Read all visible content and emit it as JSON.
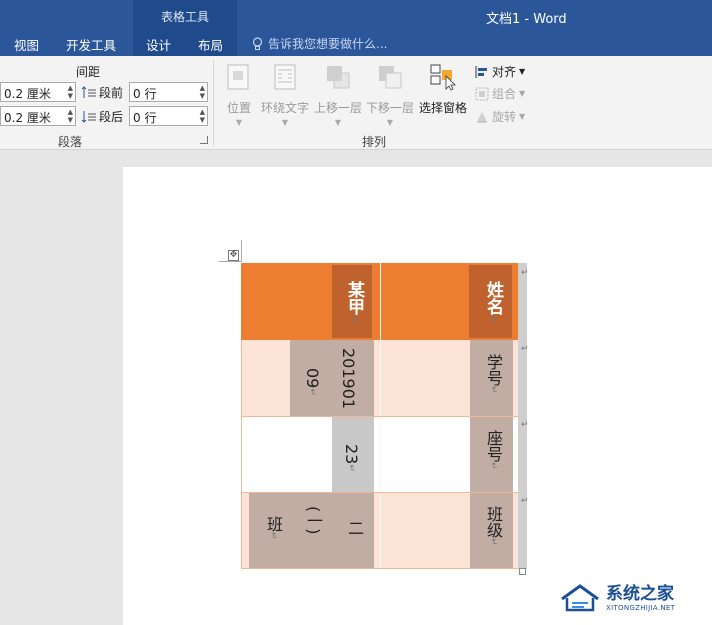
{
  "titlebar": {
    "context_group": "表格工具",
    "doc_title": "文档1 - Word",
    "tabs": [
      "视图",
      "开发工具",
      "设计",
      "布局"
    ],
    "tell_me": "告诉我您想要做什么..."
  },
  "ribbon": {
    "spacing_title": "间距",
    "indent_left_value": "0.2 厘米",
    "indent_right_value": "0.2 厘米",
    "before_label": "段前",
    "after_label": "段后",
    "before_value": "0 行",
    "after_value": "0 行",
    "paragraph_group": "段落",
    "arrange_group": "排列",
    "buttons": {
      "position": "位置",
      "wrap_text": "环绕文字",
      "bring_forward": "上移一层",
      "send_backward": "下移一层",
      "selection_pane": "选择窗格",
      "align": "对齐",
      "group": "组合",
      "rotate": "旋转"
    }
  },
  "table": {
    "row1": {
      "left": "某甲",
      "right": "姓名"
    },
    "row2": {
      "left_line1": "201901",
      "left_line2": "09",
      "right": "学号"
    },
    "row3": {
      "left": "23",
      "right": "座号"
    },
    "row4": {
      "left_line1": "二",
      "left_line2": "(一)",
      "left_line3": "班",
      "right": "班级"
    },
    "para_mark": "↵"
  },
  "watermark": {
    "cn": "系统之家",
    "en": "XITONGZHIJIA.NET"
  },
  "colors": {
    "title_bar": "#2b579a",
    "header_row": "#ed7d31",
    "light_row": "#fbe4d5",
    "shade_brown": "#c1ada3"
  }
}
